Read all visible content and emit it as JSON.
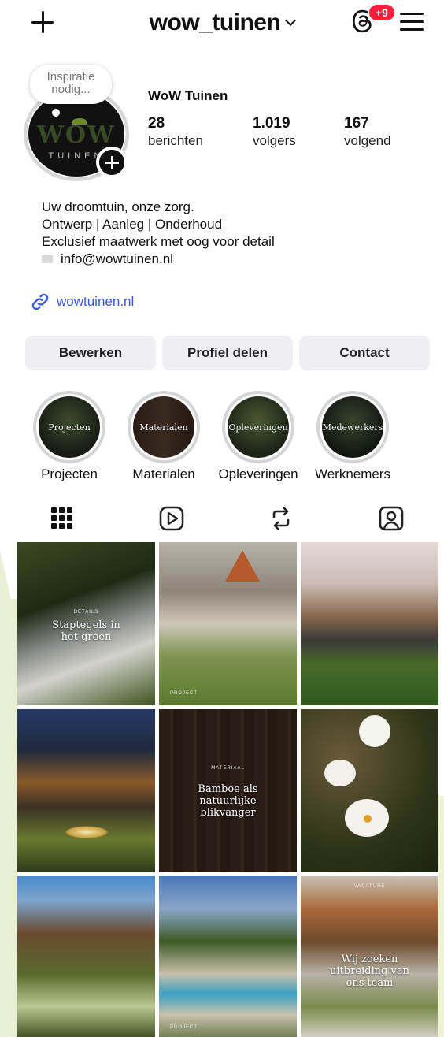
{
  "header": {
    "username": "wow_tuinen",
    "notification_badge": "+9"
  },
  "profile": {
    "note": "Inspiratie nodig...",
    "logo_text": "WOW",
    "logo_subtext": "TUINEN",
    "display_name": "WoW Tuinen",
    "stats": [
      {
        "value": "28",
        "label": "berichten"
      },
      {
        "value": "1.019",
        "label": "volgers"
      },
      {
        "value": "167",
        "label": "volgend"
      }
    ],
    "bio": [
      "Uw droomtuin, onze zorg.",
      "Ontwerp | Aanleg | Onderhoud",
      "Exclusief maatwerk met oog voor detail"
    ],
    "email": "info@wowtuinen.nl",
    "link": "wowtuinen.nl"
  },
  "actions": {
    "edit": "Bewerken",
    "share": "Profiel delen",
    "contact": "Contact"
  },
  "highlights": [
    {
      "cover_text": "Projecten",
      "label": "Projecten"
    },
    {
      "cover_text": "Materialen",
      "label": "Materialen"
    },
    {
      "cover_text": "Opleveringen",
      "label": "Opleveringen"
    },
    {
      "cover_text": "Medewerkers",
      "label": "Werknemers"
    }
  ],
  "posts": [
    {
      "caption_small": "DETAILS",
      "title": "Staptegels in het groen",
      "tag": ""
    },
    {
      "caption_small": "",
      "title": "",
      "tag": "PROJECT"
    },
    {
      "caption_small": "",
      "title": "",
      "tag": ""
    },
    {
      "caption_small": "",
      "title": "",
      "tag": ""
    },
    {
      "caption_small": "MATERIAAL",
      "title": "Bamboe als natuurlijke blikvanger",
      "tag": ""
    },
    {
      "caption_small": "",
      "title": "",
      "tag": ""
    },
    {
      "caption_small": "",
      "title": "",
      "tag": ""
    },
    {
      "caption_small": "",
      "title": "",
      "tag": "PROJECT"
    },
    {
      "caption_small": "VACATURE",
      "title": "Wij zoeken uitbreiding van ons team",
      "tag": ""
    }
  ],
  "colors": {
    "accent_link": "#3a5bd9",
    "badge": "#ff1f3d",
    "button_bg": "#efeff3"
  }
}
